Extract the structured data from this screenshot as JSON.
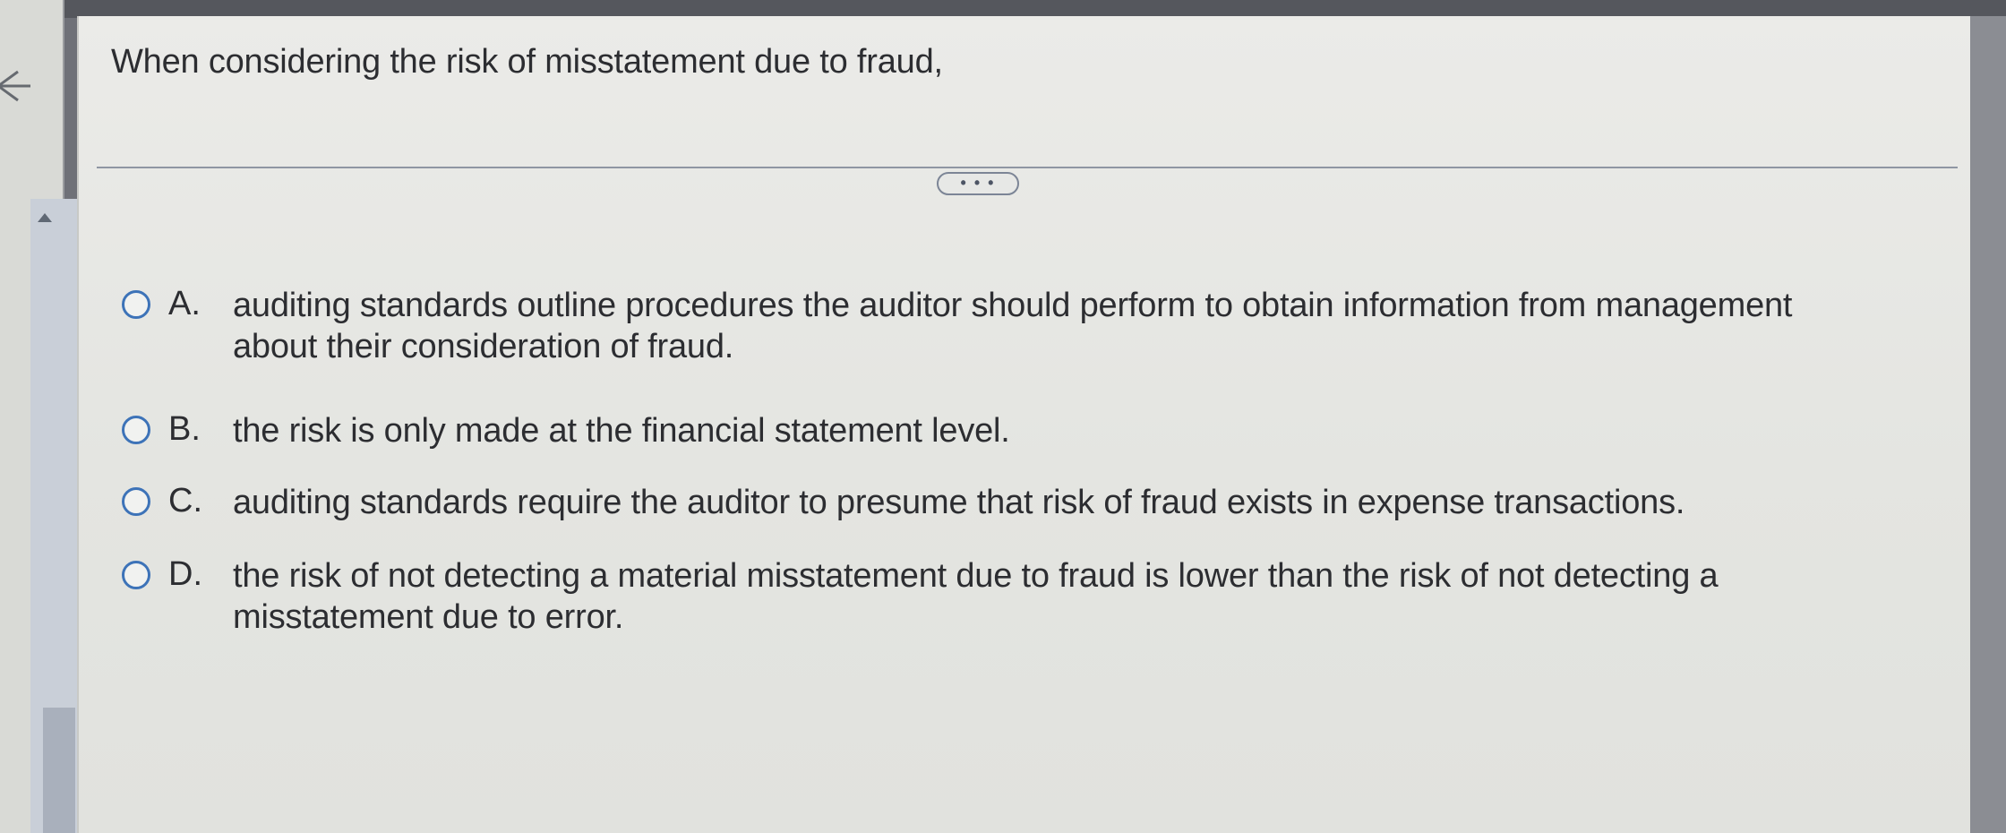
{
  "question": {
    "text": "When considering the risk of misstatement due to fraud,"
  },
  "more_button": {
    "label": "• • •"
  },
  "options": [
    {
      "letter": "A.",
      "text": "auditing standards outline procedures the auditor should perform to obtain information from management about their consideration of fraud."
    },
    {
      "letter": "B.",
      "text": "the risk is only made at the financial statement level."
    },
    {
      "letter": "C.",
      "text": "auditing standards require the auditor to presume that risk of fraud exists in expense transactions."
    },
    {
      "letter": "D.",
      "text": "the risk of not detecting a material misstatement due to fraud is lower than the risk of not detecting a misstatement due to error."
    }
  ],
  "colors": {
    "radio_border": "#3d73b8",
    "text": "#2c2d31",
    "panel_bg": "#e6e7e3"
  },
  "icons": {
    "back": "back-arrow-icon",
    "scroll_up": "caret-up-icon"
  }
}
